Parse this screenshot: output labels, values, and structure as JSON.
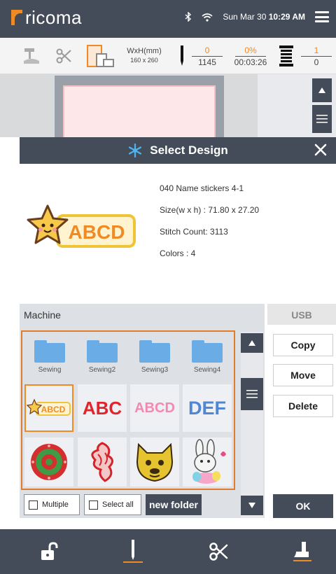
{
  "topbar": {
    "brand": "ricoma",
    "date": "Sun Mar 30",
    "time": "10:29 AM",
    "icons": [
      "bluetooth-icon",
      "wifi-icon",
      "menu-icon"
    ]
  },
  "statusbar": {
    "size_label": "WxH(mm)",
    "size_value": "160 x 260",
    "stitch_current": "0",
    "stitch_total": "1145",
    "percent": "0%",
    "elapsed": "00:03:26",
    "color_current": "1",
    "color_total": "0",
    "colors": {
      "accent": "#f08a24"
    }
  },
  "dialog": {
    "title": "Select Design",
    "design_name": "040 Name stickers 4-1",
    "size_text": "Size(w x h) :  71.80 x 27.20",
    "stitch_count": "Stitch Count: 3113",
    "colors_text": "Colors    : 4",
    "preview_text": "ABCD"
  },
  "panel": {
    "tab_machine": "Machine",
    "tab_usb": "USB",
    "folders": [
      "Sewing",
      "Sewing2",
      "Sewing3",
      "Sewing4"
    ],
    "designs_row1": [
      "ABCD",
      "ABC",
      "ABCD",
      "DEF"
    ],
    "designs_row2": [
      "mandala",
      "dragon",
      "bulldog",
      "bunny"
    ],
    "buttons": {
      "copy": "Copy",
      "move": "Move",
      "delete": "Delete",
      "ok": "OK"
    },
    "multiple": "Multiple",
    "select_all": "Select all",
    "new_folder": "new folder"
  },
  "bottombar": {
    "icons": [
      "unlock-icon",
      "needle-icon",
      "scissors-icon",
      "presser-foot-icon"
    ]
  }
}
